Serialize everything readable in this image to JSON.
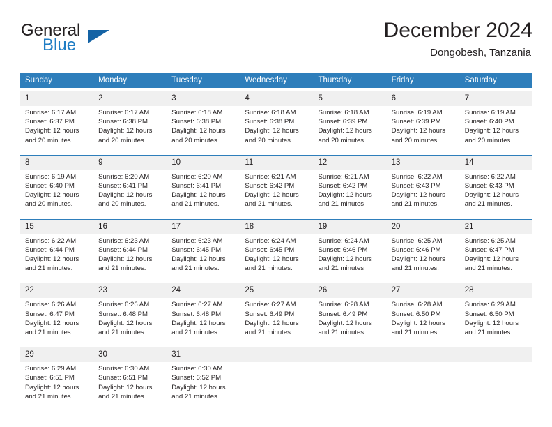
{
  "brand": {
    "name_top": "General",
    "name_bottom": "Blue",
    "colors": {
      "text_dark": "#231f20",
      "blue_text": "#1f7dc4",
      "triangle": "#1463a5",
      "header_blue": "#2e7ebb",
      "daynum_band": "#f0f0f0"
    }
  },
  "header": {
    "title": "December 2024",
    "subtitle": "Dongobesh, Tanzania"
  },
  "weekdays": [
    "Sunday",
    "Monday",
    "Tuesday",
    "Wednesday",
    "Thursday",
    "Friday",
    "Saturday"
  ],
  "weeks": [
    {
      "days": [
        {
          "num": "1",
          "sunrise": "Sunrise: 6:17 AM",
          "sunset": "Sunset: 6:37 PM",
          "daylight1": "Daylight: 12 hours",
          "daylight2": "and 20 minutes."
        },
        {
          "num": "2",
          "sunrise": "Sunrise: 6:17 AM",
          "sunset": "Sunset: 6:38 PM",
          "daylight1": "Daylight: 12 hours",
          "daylight2": "and 20 minutes."
        },
        {
          "num": "3",
          "sunrise": "Sunrise: 6:18 AM",
          "sunset": "Sunset: 6:38 PM",
          "daylight1": "Daylight: 12 hours",
          "daylight2": "and 20 minutes."
        },
        {
          "num": "4",
          "sunrise": "Sunrise: 6:18 AM",
          "sunset": "Sunset: 6:38 PM",
          "daylight1": "Daylight: 12 hours",
          "daylight2": "and 20 minutes."
        },
        {
          "num": "5",
          "sunrise": "Sunrise: 6:18 AM",
          "sunset": "Sunset: 6:39 PM",
          "daylight1": "Daylight: 12 hours",
          "daylight2": "and 20 minutes."
        },
        {
          "num": "6",
          "sunrise": "Sunrise: 6:19 AM",
          "sunset": "Sunset: 6:39 PM",
          "daylight1": "Daylight: 12 hours",
          "daylight2": "and 20 minutes."
        },
        {
          "num": "7",
          "sunrise": "Sunrise: 6:19 AM",
          "sunset": "Sunset: 6:40 PM",
          "daylight1": "Daylight: 12 hours",
          "daylight2": "and 20 minutes."
        }
      ]
    },
    {
      "days": [
        {
          "num": "8",
          "sunrise": "Sunrise: 6:19 AM",
          "sunset": "Sunset: 6:40 PM",
          "daylight1": "Daylight: 12 hours",
          "daylight2": "and 20 minutes."
        },
        {
          "num": "9",
          "sunrise": "Sunrise: 6:20 AM",
          "sunset": "Sunset: 6:41 PM",
          "daylight1": "Daylight: 12 hours",
          "daylight2": "and 20 minutes."
        },
        {
          "num": "10",
          "sunrise": "Sunrise: 6:20 AM",
          "sunset": "Sunset: 6:41 PM",
          "daylight1": "Daylight: 12 hours",
          "daylight2": "and 21 minutes."
        },
        {
          "num": "11",
          "sunrise": "Sunrise: 6:21 AM",
          "sunset": "Sunset: 6:42 PM",
          "daylight1": "Daylight: 12 hours",
          "daylight2": "and 21 minutes."
        },
        {
          "num": "12",
          "sunrise": "Sunrise: 6:21 AM",
          "sunset": "Sunset: 6:42 PM",
          "daylight1": "Daylight: 12 hours",
          "daylight2": "and 21 minutes."
        },
        {
          "num": "13",
          "sunrise": "Sunrise: 6:22 AM",
          "sunset": "Sunset: 6:43 PM",
          "daylight1": "Daylight: 12 hours",
          "daylight2": "and 21 minutes."
        },
        {
          "num": "14",
          "sunrise": "Sunrise: 6:22 AM",
          "sunset": "Sunset: 6:43 PM",
          "daylight1": "Daylight: 12 hours",
          "daylight2": "and 21 minutes."
        }
      ]
    },
    {
      "days": [
        {
          "num": "15",
          "sunrise": "Sunrise: 6:22 AM",
          "sunset": "Sunset: 6:44 PM",
          "daylight1": "Daylight: 12 hours",
          "daylight2": "and 21 minutes."
        },
        {
          "num": "16",
          "sunrise": "Sunrise: 6:23 AM",
          "sunset": "Sunset: 6:44 PM",
          "daylight1": "Daylight: 12 hours",
          "daylight2": "and 21 minutes."
        },
        {
          "num": "17",
          "sunrise": "Sunrise: 6:23 AM",
          "sunset": "Sunset: 6:45 PM",
          "daylight1": "Daylight: 12 hours",
          "daylight2": "and 21 minutes."
        },
        {
          "num": "18",
          "sunrise": "Sunrise: 6:24 AM",
          "sunset": "Sunset: 6:45 PM",
          "daylight1": "Daylight: 12 hours",
          "daylight2": "and 21 minutes."
        },
        {
          "num": "19",
          "sunrise": "Sunrise: 6:24 AM",
          "sunset": "Sunset: 6:46 PM",
          "daylight1": "Daylight: 12 hours",
          "daylight2": "and 21 minutes."
        },
        {
          "num": "20",
          "sunrise": "Sunrise: 6:25 AM",
          "sunset": "Sunset: 6:46 PM",
          "daylight1": "Daylight: 12 hours",
          "daylight2": "and 21 minutes."
        },
        {
          "num": "21",
          "sunrise": "Sunrise: 6:25 AM",
          "sunset": "Sunset: 6:47 PM",
          "daylight1": "Daylight: 12 hours",
          "daylight2": "and 21 minutes."
        }
      ]
    },
    {
      "days": [
        {
          "num": "22",
          "sunrise": "Sunrise: 6:26 AM",
          "sunset": "Sunset: 6:47 PM",
          "daylight1": "Daylight: 12 hours",
          "daylight2": "and 21 minutes."
        },
        {
          "num": "23",
          "sunrise": "Sunrise: 6:26 AM",
          "sunset": "Sunset: 6:48 PM",
          "daylight1": "Daylight: 12 hours",
          "daylight2": "and 21 minutes."
        },
        {
          "num": "24",
          "sunrise": "Sunrise: 6:27 AM",
          "sunset": "Sunset: 6:48 PM",
          "daylight1": "Daylight: 12 hours",
          "daylight2": "and 21 minutes."
        },
        {
          "num": "25",
          "sunrise": "Sunrise: 6:27 AM",
          "sunset": "Sunset: 6:49 PM",
          "daylight1": "Daylight: 12 hours",
          "daylight2": "and 21 minutes."
        },
        {
          "num": "26",
          "sunrise": "Sunrise: 6:28 AM",
          "sunset": "Sunset: 6:49 PM",
          "daylight1": "Daylight: 12 hours",
          "daylight2": "and 21 minutes."
        },
        {
          "num": "27",
          "sunrise": "Sunrise: 6:28 AM",
          "sunset": "Sunset: 6:50 PM",
          "daylight1": "Daylight: 12 hours",
          "daylight2": "and 21 minutes."
        },
        {
          "num": "28",
          "sunrise": "Sunrise: 6:29 AM",
          "sunset": "Sunset: 6:50 PM",
          "daylight1": "Daylight: 12 hours",
          "daylight2": "and 21 minutes."
        }
      ]
    },
    {
      "days": [
        {
          "num": "29",
          "sunrise": "Sunrise: 6:29 AM",
          "sunset": "Sunset: 6:51 PM",
          "daylight1": "Daylight: 12 hours",
          "daylight2": "and 21 minutes."
        },
        {
          "num": "30",
          "sunrise": "Sunrise: 6:30 AM",
          "sunset": "Sunset: 6:51 PM",
          "daylight1": "Daylight: 12 hours",
          "daylight2": "and 21 minutes."
        },
        {
          "num": "31",
          "sunrise": "Sunrise: 6:30 AM",
          "sunset": "Sunset: 6:52 PM",
          "daylight1": "Daylight: 12 hours",
          "daylight2": "and 21 minutes."
        },
        {
          "num": "",
          "sunrise": "",
          "sunset": "",
          "daylight1": "",
          "daylight2": ""
        },
        {
          "num": "",
          "sunrise": "",
          "sunset": "",
          "daylight1": "",
          "daylight2": ""
        },
        {
          "num": "",
          "sunrise": "",
          "sunset": "",
          "daylight1": "",
          "daylight2": ""
        },
        {
          "num": "",
          "sunrise": "",
          "sunset": "",
          "daylight1": "",
          "daylight2": ""
        }
      ]
    }
  ]
}
